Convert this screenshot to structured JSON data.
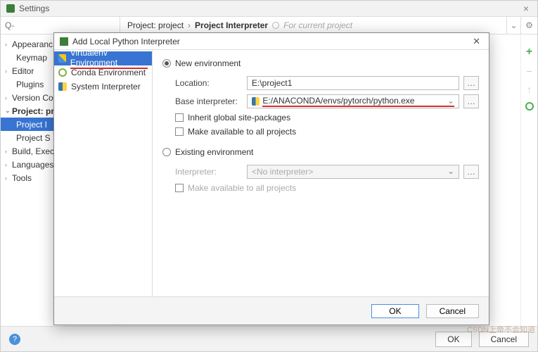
{
  "window": {
    "title": "Settings",
    "search_placeholder": "Q-"
  },
  "breadcrumb": {
    "root": "Project: project",
    "sep": "›",
    "current": "Project Interpreter",
    "hint": "For current project"
  },
  "tree": {
    "appearance": "Appearanc",
    "keymap": "Keymap",
    "editor": "Editor",
    "plugins": "Plugins",
    "version": "Version Co",
    "project": "Project: pr",
    "project_i": "Project I",
    "project_s": "Project S",
    "build": "Build, Exec",
    "languages": "Languages",
    "tools": "Tools"
  },
  "buttons": {
    "ok": "OK",
    "cancel": "Cancel"
  },
  "modal": {
    "title": "Add Local Python Interpreter",
    "side": {
      "virtualenv": "Virtualenv Environment",
      "conda": "Conda Environment",
      "system": "System Interpreter"
    },
    "form": {
      "new_env": "New environment",
      "location_label": "Location:",
      "location_value": "E:\\project1",
      "base_label": "Base interpreter:",
      "base_value": "E:/ANACONDA/envs/pytorch/python.exe",
      "inherit": "Inherit global site-packages",
      "make_avail": "Make available to all projects",
      "existing_env": "Existing environment",
      "interpreter_label": "Interpreter:",
      "interpreter_value": "<No interpreter>",
      "make_avail2": "Make available to all projects"
    }
  },
  "watermark": "CSDN上帝不会知道"
}
